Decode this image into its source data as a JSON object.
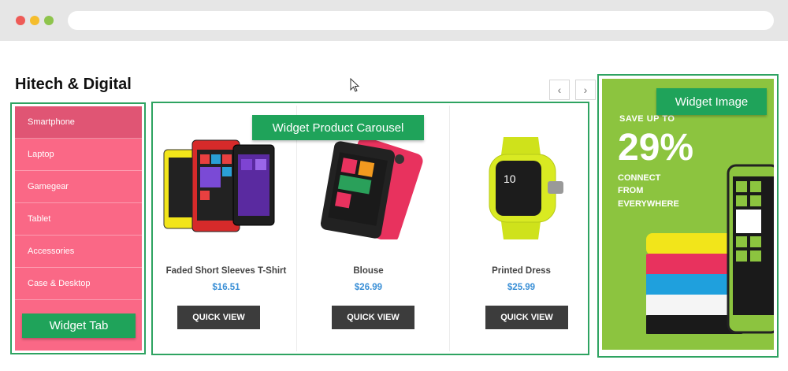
{
  "browser": {
    "dots": [
      "#ee5b57",
      "#f5bd2d",
      "#8ec44c"
    ]
  },
  "page": {
    "title": "Hitech & Digital"
  },
  "carousel_nav": {
    "prev": "‹",
    "next": "›"
  },
  "widget_tab": {
    "items": [
      "Smartphone",
      "Laptop",
      "Gamegear",
      "Tablet",
      "Accessories",
      "Case & Desktop"
    ],
    "active": "Smartphone",
    "label": "Widget Tab"
  },
  "widget_carousel": {
    "label": "Widget Product Carousel",
    "products": [
      {
        "name": "Faded Short Sleeves T-Shirt",
        "price": "$16.51",
        "button": "QUICK VIEW"
      },
      {
        "name": "Blouse",
        "price": "$26.99",
        "button": "QUICK VIEW"
      },
      {
        "name": "Printed Dress",
        "price": "$25.99",
        "button": "QUICK VIEW"
      }
    ]
  },
  "widget_image": {
    "label": "Widget Image",
    "ad": {
      "kicker": "SAVE UP TO",
      "headline": "29%",
      "lines": [
        "CONNECT",
        "FROM",
        "EVERYWHERE"
      ]
    }
  },
  "colors": {
    "accent_green": "#1fa35a",
    "tab_pink": "#fa6886",
    "price_blue": "#3a8fd6",
    "ad_green": "#8cc43f"
  }
}
